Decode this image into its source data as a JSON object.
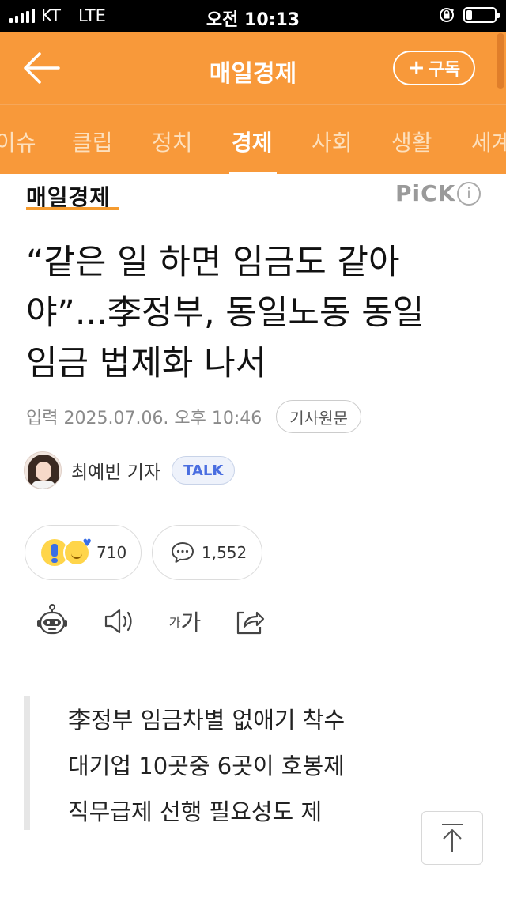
{
  "status_bar": {
    "carrier": "KT",
    "network": "LTE",
    "time": "오전 10:13"
  },
  "header": {
    "back_icon": "arrow-left-icon",
    "title": "매일경제",
    "subscribe_label": "구독",
    "subscribe_icon": "plus-icon",
    "background_color": "#f8993a"
  },
  "tabs": [
    {
      "label": "이슈"
    },
    {
      "label": "클립"
    },
    {
      "label": "정치"
    },
    {
      "label": "경제",
      "active": true
    },
    {
      "label": "사회"
    },
    {
      "label": "생활"
    },
    {
      "label": "세계"
    }
  ],
  "article": {
    "publisher": "매일경제",
    "pick_label": "PiCK",
    "info_icon": "info-icon",
    "headline_lines": [
      "“같은 일 하면 임금도 같아",
      "야”...李정부, 동일노동 동일",
      "임금 법제화 나서"
    ],
    "published": "입력 2025.07.06. 오후 10:46",
    "original_link_label": "기사원문",
    "reporter": "최예빈 기자",
    "talk_label": "TALK",
    "reaction_count": "710",
    "comment_count": "1,552",
    "tools": {
      "robot_icon": "summary-bot-icon",
      "speaker_icon": "speaker-icon",
      "font_small": "가",
      "font_large": "가",
      "share_icon": "share-icon"
    },
    "summary_lines": [
      "李정부 임금차별 없애기 착수",
      "대기업 10곳중 6곳이 호봉제",
      "직무급제 선행 필요성도 제"
    ]
  }
}
